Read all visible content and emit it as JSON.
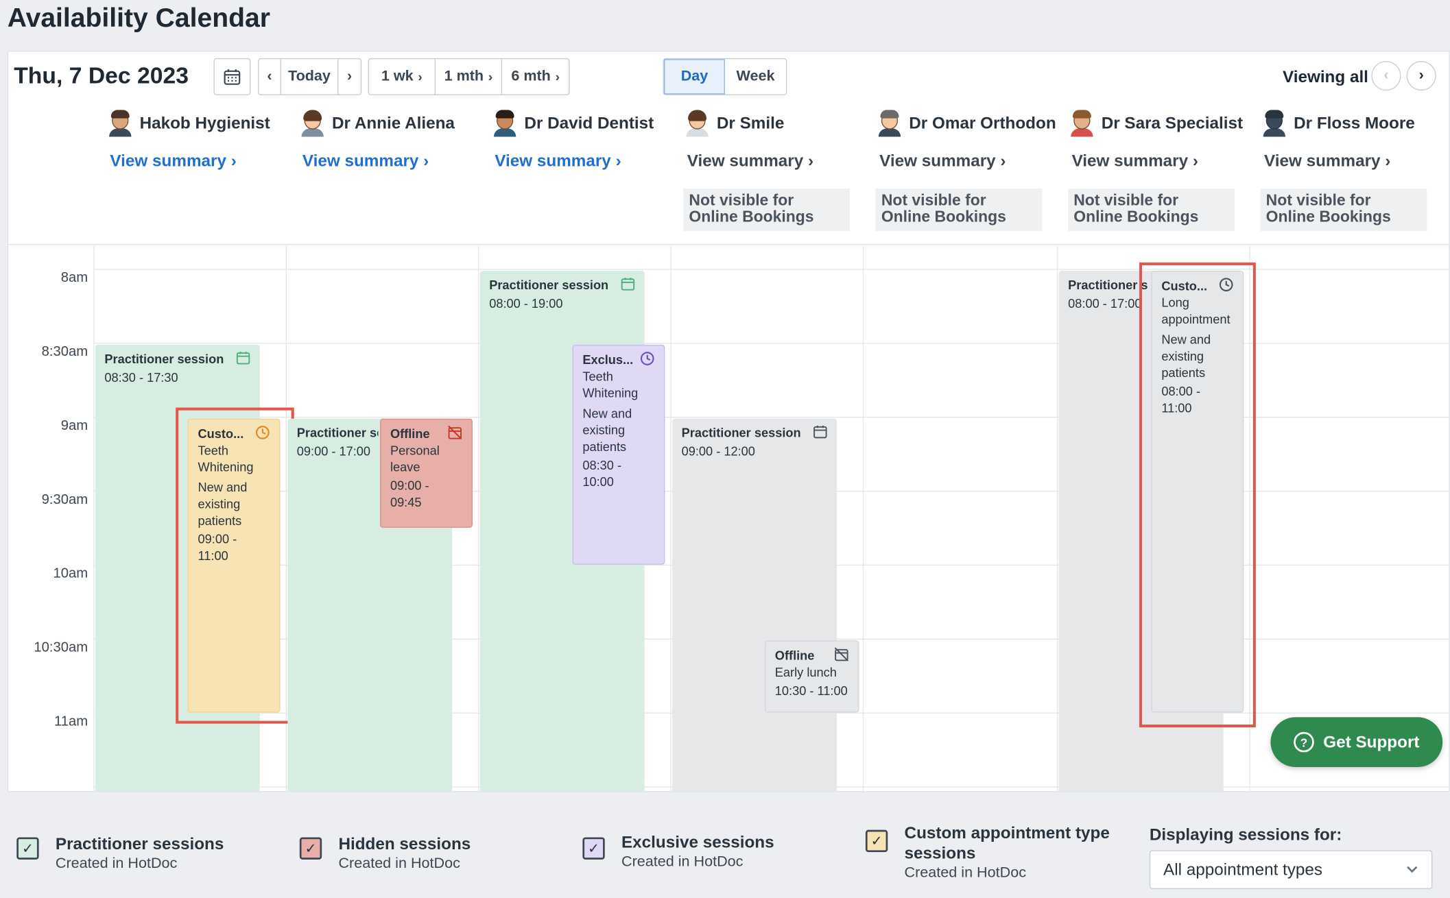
{
  "page_title": "Availability Calendar",
  "toolbar": {
    "date": "Thu, 7 Dec 2023",
    "today": "Today",
    "jump_1wk": "1 wk",
    "jump_1mth": "1 mth",
    "jump_6mth": "6 mth",
    "view_day": "Day",
    "view_week": "Week",
    "viewing_all": "Viewing all",
    "active_view": "Day"
  },
  "practitioners": [
    {
      "name": "Hakob Hygienist",
      "summary": "View summary",
      "summary_style": "blue",
      "not_visible": ""
    },
    {
      "name": "Dr Annie Aliena",
      "summary": "View summary",
      "summary_style": "blue",
      "not_visible": ""
    },
    {
      "name": "Dr David Dentist",
      "summary": "View summary",
      "summary_style": "blue",
      "not_visible": ""
    },
    {
      "name": "Dr Smile",
      "summary": "View summary",
      "summary_style": "gray",
      "not_visible": "Not visible for Online Bookings"
    },
    {
      "name": "Dr Omar Orthodon",
      "summary": "View summary",
      "summary_style": "gray",
      "not_visible": "Not visible for Online Bookings"
    },
    {
      "name": "Dr Sara Specialist",
      "summary": "View summary",
      "summary_style": "gray",
      "not_visible": "Not visible for Online Bookings"
    },
    {
      "name": "Dr Floss Moore",
      "summary": "View summary",
      "summary_style": "gray",
      "not_visible": "Not visible for Online Bookings"
    }
  ],
  "time_labels": [
    "8am",
    "8:30am",
    "9am",
    "9:30am",
    "10am",
    "10:30am",
    "11am"
  ],
  "events": {
    "hakob_session": {
      "title": "Practitioner session",
      "time": "08:30 - 17:30"
    },
    "hakob_custom": {
      "title": "Custo...",
      "line1": "Teeth Whitening",
      "line2": "New and existing patients",
      "time": "09:00 - 11:00"
    },
    "annie_session": {
      "title": "Practitioner se",
      "time": "09:00 - 17:00"
    },
    "annie_offline": {
      "title": "Offline",
      "line1": "Personal leave",
      "time": "09:00 - 09:45"
    },
    "david_session": {
      "title": "Practitioner session",
      "time": "08:00 - 19:00"
    },
    "david_exclusive": {
      "title": "Exclus...",
      "line1": "Teeth Whitening",
      "line2": "New and existing patients",
      "time": "08:30 - 10:00"
    },
    "smile_session": {
      "title": "Practitioner session",
      "time": "09:00 - 12:00"
    },
    "smile_offline": {
      "title": "Offline",
      "line1": "Early lunch",
      "time": "10:30 - 11:00"
    },
    "sara_session": {
      "title": "Practitioner se",
      "time": "08:00 - 17:00"
    },
    "sara_custom": {
      "title": "Custo...",
      "line1": "Long appointment",
      "line2": "New and existing patients",
      "time": "08:00 - 11:00"
    }
  },
  "support": {
    "label": "Get Support"
  },
  "legend": {
    "practitioner": {
      "title": "Practitioner sessions",
      "sub": "Created in HotDoc"
    },
    "hidden": {
      "title": "Hidden sessions",
      "sub": "Created in HotDoc"
    },
    "exclusive": {
      "title": "Exclusive sessions",
      "sub": "Created in HotDoc"
    },
    "custom": {
      "title": "Custom appointment type sessions",
      "sub": "Created in HotDoc"
    },
    "displaying_label": "Displaying sessions for:",
    "displaying_value": "All appointment types"
  },
  "colors": {
    "practitioner": "#d7ede2",
    "hidden": "#e6e7e9",
    "custom": "#f8e3b4",
    "exclusive": "#e0d9f5",
    "offline": "#e7afa8",
    "accent": "#1f6fcf",
    "highlight": "#e2574c",
    "support": "#2e8a4f"
  }
}
